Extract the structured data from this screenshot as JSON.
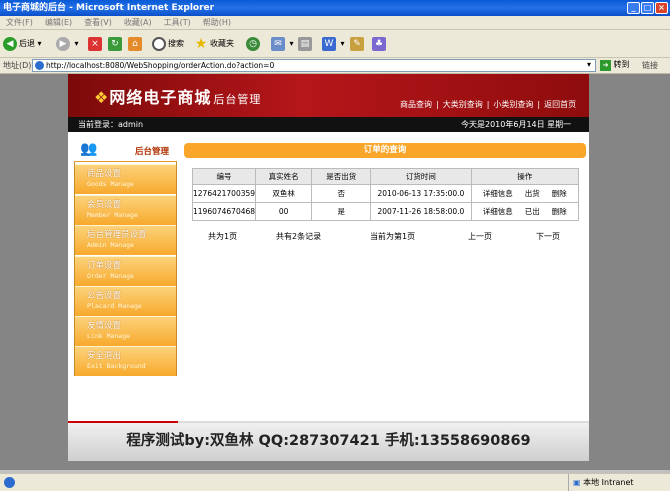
{
  "window": {
    "title": "电子商城的后台 - Microsoft Internet Explorer"
  },
  "menu": [
    "文件(F)",
    "编辑(E)",
    "查看(V)",
    "收藏(A)",
    "工具(T)",
    "帮助(H)"
  ],
  "toolbar": {
    "back": "后退",
    "search": "搜索",
    "favorites": "收藏夹"
  },
  "address": {
    "label": "地址(D)",
    "url": "http://localhost:8080/WebShopping/orderAction.do?action=0",
    "go": "转到",
    "links": "链接"
  },
  "site": {
    "logo_main": "网络电子商城",
    "logo_sub": "后台管理",
    "nav": [
      "商品查询",
      "大类别查询",
      "小类别查询",
      "返回首页"
    ],
    "current_user": "当前登录：admin",
    "date_text": "今天是2010年6月14日 星期一"
  },
  "sidebar": {
    "title": "后台管理",
    "items": [
      {
        "cn": "商品设置",
        "en": "Goods Manage"
      },
      {
        "cn": "会员设置",
        "en": "Member Manage"
      },
      {
        "cn": "后台管理员设置",
        "en": "Admin Manage"
      },
      {
        "cn": "订单设置",
        "en": "Order Manage"
      },
      {
        "cn": "公告设置",
        "en": "Placard Manage"
      },
      {
        "cn": "友情设置",
        "en": "Link Manage"
      },
      {
        "cn": "安全退出",
        "en": "Exit Background"
      }
    ]
  },
  "main": {
    "title": "订单的查询",
    "headers": [
      "编号",
      "真实姓名",
      "是否出货",
      "订货时间",
      "操作"
    ],
    "rows": [
      {
        "id": "1276421700359",
        "name": "双鱼林",
        "shipped": "否",
        "time": "2010-06-13 17:35:00.0",
        "op1": "详细信息",
        "op2": "出货",
        "op3": "删除"
      },
      {
        "id": "1196074670468",
        "name": "00",
        "shipped": "是",
        "time": "2007-11-26 18:58:00.0",
        "op1": "详细信息",
        "op2": "已出",
        "op3": "删除"
      }
    ],
    "pager": {
      "total_pages": "共为1页",
      "total_records": "共有2条记录",
      "current": "当前为第1页",
      "prev": "上一页",
      "next": "下一页"
    }
  },
  "footer": {
    "text": "程序测试by:双鱼林 QQ:287307421 手机:13558690869"
  },
  "status": {
    "zone": "本地 Intranet"
  }
}
